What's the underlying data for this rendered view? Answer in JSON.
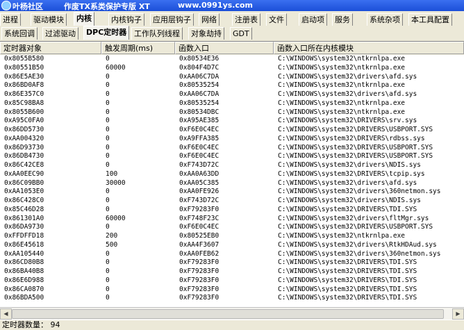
{
  "title": {
    "site": "叶杨社区",
    "name": "作废TX系类保护专版 XT",
    "url": "www.0991ys.com"
  },
  "tabs_main": [
    "进程",
    "驱动模块",
    "内核",
    "内核钩子",
    "应用层钩子",
    "网络",
    "注册表",
    "文件",
    "启动项",
    "服务",
    "系统杂项",
    "本工具配置"
  ],
  "tabs_sub": [
    "系统回调",
    "过滤驱动",
    "DPC定时器",
    "工作队列线程",
    "对象劫持",
    "GDT"
  ],
  "table": {
    "columns": [
      "定时器对象",
      "触发周期(ms)",
      "函数入口",
      "函数入口所在内核模块"
    ],
    "rows": [
      [
        "0x8055B580",
        "0",
        "0x80534E36",
        "C:\\WINDOWS\\system32\\ntkrnlpa.exe"
      ],
      [
        "0x80551B50",
        "60000",
        "0x804F4D7C",
        "C:\\WINDOWS\\system32\\ntkrnlpa.exe"
      ],
      [
        "0x86E5AE30",
        "0",
        "0xAA06C7DA",
        "C:\\WINDOWS\\system32\\drivers\\afd.sys"
      ],
      [
        "0x86BD0AF8",
        "0",
        "0x80535254",
        "C:\\WINDOWS\\system32\\ntkrnlpa.exe"
      ],
      [
        "0x86E357C0",
        "0",
        "0xAA06C7DA",
        "C:\\WINDOWS\\system32\\drivers\\afd.sys"
      ],
      [
        "0x85C98BA8",
        "0",
        "0x80535254",
        "C:\\WINDOWS\\system32\\ntkrnlpa.exe"
      ],
      [
        "0x8055B600",
        "0",
        "0x80534DBC",
        "C:\\WINDOWS\\system32\\ntkrnlpa.exe"
      ],
      [
        "0xA95C0FA0",
        "0",
        "0xA95AE385",
        "C:\\WINDOWS\\system32\\DRIVERS\\srv.sys"
      ],
      [
        "0x86DD5730",
        "0",
        "0xF6E0C4EC",
        "C:\\WINDOWS\\system32\\DRIVERS\\USBPORT.SYS"
      ],
      [
        "0xAA004320",
        "0",
        "0xA9FFA385",
        "C:\\WINDOWS\\system32\\DRIVERS\\rdbss.sys"
      ],
      [
        "0x86D93730",
        "0",
        "0xF6E0C4EC",
        "C:\\WINDOWS\\system32\\DRIVERS\\USBPORT.SYS"
      ],
      [
        "0x86DB4730",
        "0",
        "0xF6E0C4EC",
        "C:\\WINDOWS\\system32\\DRIVERS\\USBPORT.SYS"
      ],
      [
        "0x86C42CE8",
        "0",
        "0xF743D72C",
        "C:\\WINDOWS\\system32\\drivers\\NDIS.sys"
      ],
      [
        "0xAA0EEC90",
        "100",
        "0xAA0A63DD",
        "C:\\WINDOWS\\system32\\DRIVERS\\tcpip.sys"
      ],
      [
        "0x86C09BB0",
        "30000",
        "0xAA05C385",
        "C:\\WINDOWS\\system32\\drivers\\afd.sys"
      ],
      [
        "0xAA1053E0",
        "0",
        "0xAA0FE926",
        "C:\\WINDOWS\\system32\\drivers\\360netmon.sys"
      ],
      [
        "0x86C428C0",
        "0",
        "0xF743D72C",
        "C:\\WINDOWS\\system32\\drivers\\NDIS.sys"
      ],
      [
        "0x85C46D28",
        "0",
        "0xF79283F0",
        "C:\\WINDOWS\\system32\\DRIVERS\\TDI.SYS"
      ],
      [
        "0x861301A0",
        "60000",
        "0xF748F23C",
        "C:\\WINDOWS\\system32\\drivers\\fltMgr.sys"
      ],
      [
        "0x86DA9730",
        "0",
        "0xF6E0C4EC",
        "C:\\WINDOWS\\system32\\DRIVERS\\USBPORT.SYS"
      ],
      [
        "0xFFDFFD18",
        "200",
        "0x80525EB0",
        "C:\\WINDOWS\\system32\\ntkrnlpa.exe"
      ],
      [
        "0x86E45618",
        "500",
        "0xAA4F3607",
        "C:\\WINDOWS\\system32\\drivers\\RtkHDAud.sys"
      ],
      [
        "0xAA105440",
        "0",
        "0xAA0FEB62",
        "C:\\WINDOWS\\system32\\drivers\\360netmon.sys"
      ],
      [
        "0x86CD80B8",
        "0",
        "0xF79283F0",
        "C:\\WINDOWS\\system32\\DRIVERS\\TDI.SYS"
      ],
      [
        "0x86BA40B8",
        "0",
        "0xF79283F0",
        "C:\\WINDOWS\\system32\\DRIVERS\\TDI.SYS"
      ],
      [
        "0x86E6D988",
        "0",
        "0xF79283F0",
        "C:\\WINDOWS\\system32\\DRIVERS\\TDI.SYS"
      ],
      [
        "0x86CA0870",
        "0",
        "0xF79283F0",
        "C:\\WINDOWS\\system32\\DRIVERS\\TDI.SYS"
      ],
      [
        "0x86BDA500",
        "0",
        "0xF79283F0",
        "C:\\WINDOWS\\system32\\DRIVERS\\TDI.SYS"
      ]
    ]
  },
  "status": {
    "label": "定时器数量：",
    "count": "94"
  }
}
